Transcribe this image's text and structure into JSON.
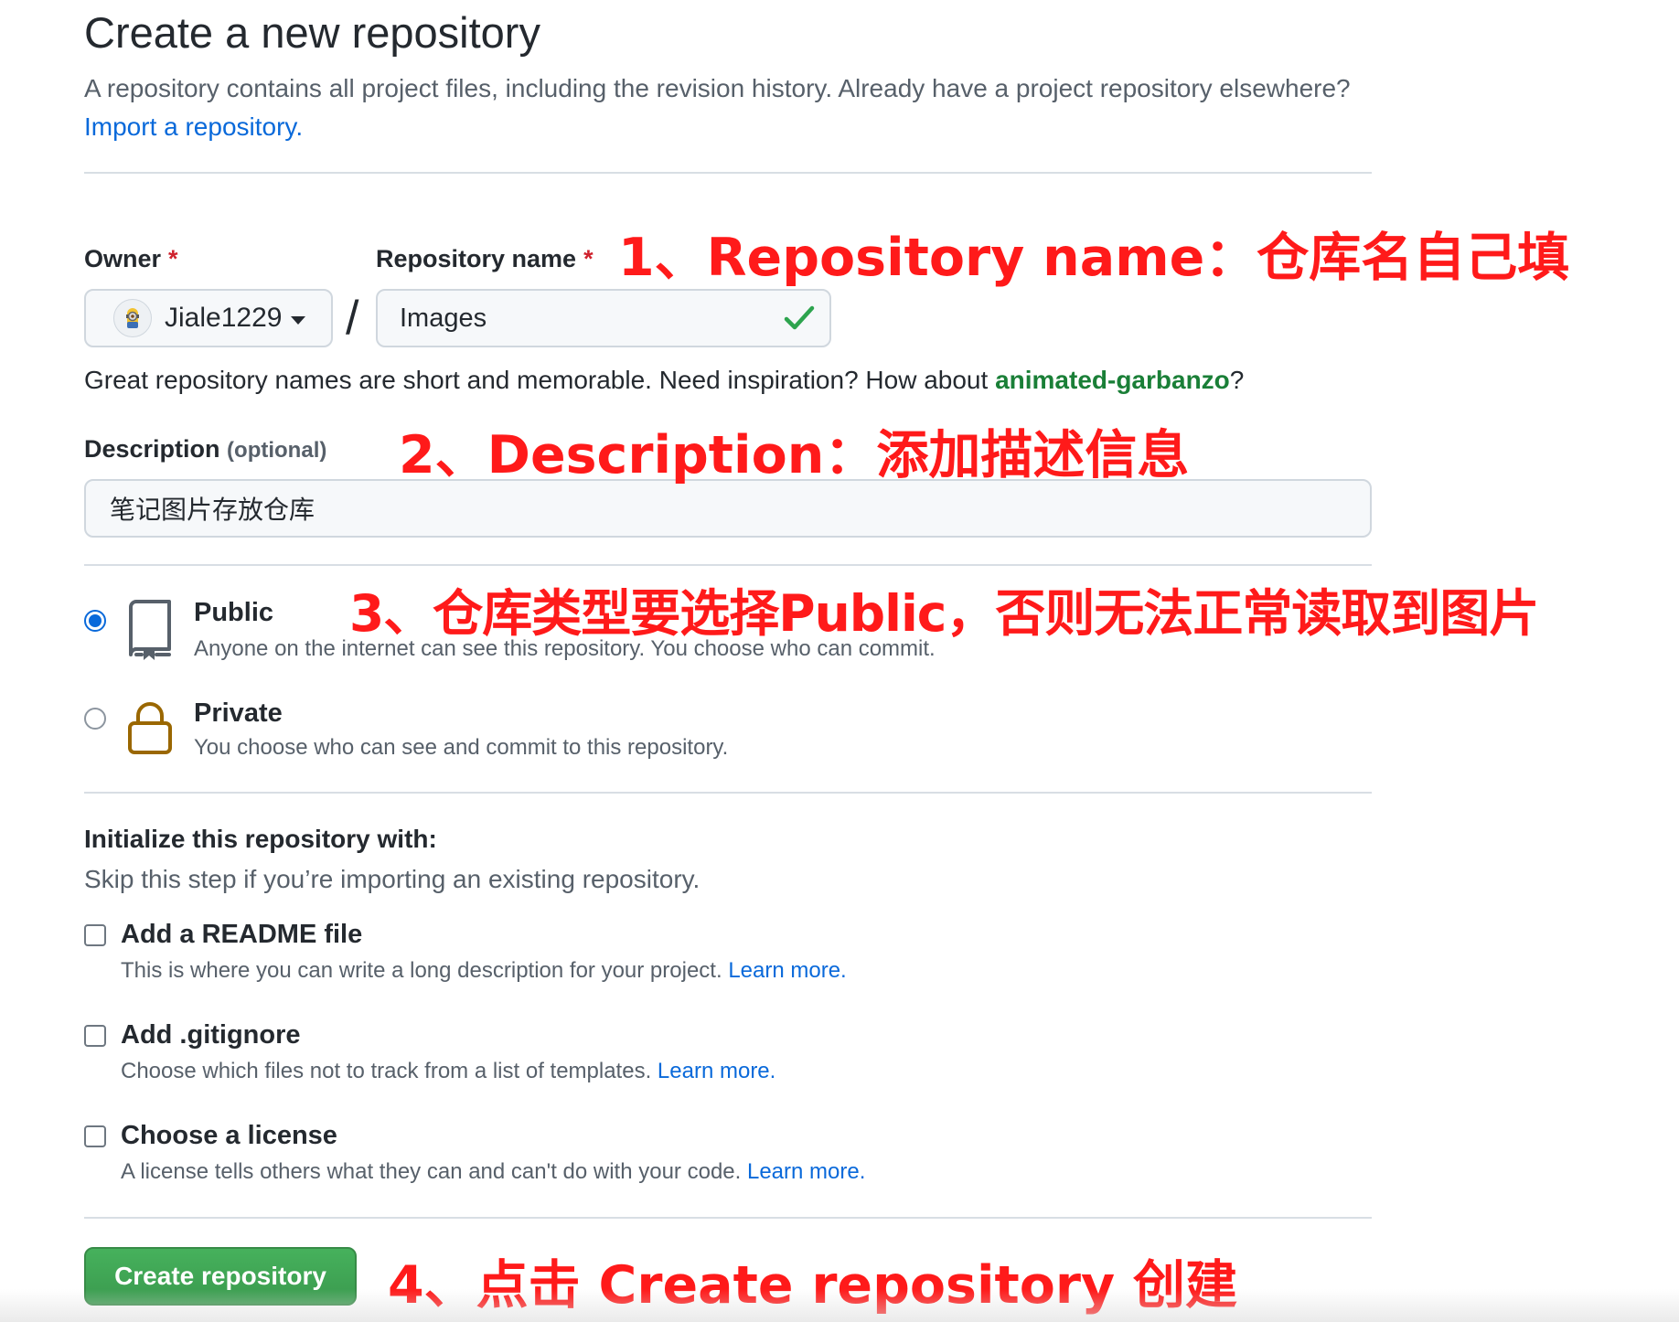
{
  "header": {
    "title": "Create a new repository",
    "intro": "A repository contains all project files, including the revision history. Already have a project repository elsewhere?",
    "import_link": "Import a repository."
  },
  "owner": {
    "label": "Owner",
    "required_mark": "*",
    "value": "Jiale1229",
    "avatar_icon": "minion-avatar"
  },
  "separator": "/",
  "repo_name": {
    "label": "Repository name",
    "required_mark": "*",
    "value": "Images",
    "valid_icon": "check-icon"
  },
  "name_hint": {
    "text": "Great repository names are short and memorable. Need inspiration? How about",
    "suggestion": "animated-garbanzo",
    "suffix": "?"
  },
  "description": {
    "label": "Description",
    "optional": "(optional)",
    "value": "笔记图片存放仓库"
  },
  "visibility": {
    "selected": "public",
    "public": {
      "title": "Public",
      "desc": "Anyone on the internet can see this repository. You choose who can commit.",
      "icon": "repo-icon"
    },
    "private": {
      "title": "Private",
      "desc": "You choose who can see and commit to this repository.",
      "icon": "lock-icon"
    }
  },
  "initialize": {
    "title": "Initialize this repository with:",
    "subtitle": "Skip this step if you’re importing an existing repository.",
    "options": [
      {
        "title": "Add a README file",
        "desc": "This is where you can write a long description for your project.",
        "link": "Learn more.",
        "checked": false
      },
      {
        "title": "Add .gitignore",
        "desc": "Choose which files not to track from a list of templates.",
        "link": "Learn more.",
        "checked": false
      },
      {
        "title": "Choose a license",
        "desc": "A license tells others what they can and can't do with your code.",
        "link": "Learn more.",
        "checked": false
      }
    ]
  },
  "create_button": "Create repository",
  "annotations": [
    "1、Repository name：仓库名自己填",
    "2、Description：添加描述信息",
    "3、仓库类型要选择Public，否则无法正常读取到图片",
    "4、点击 Create repository 创建"
  ],
  "colors": {
    "link": "#0969da",
    "suggestion": "#1a7f37",
    "annotation": "#ff1a1a",
    "button": "#2da44e",
    "required": "#cf222e"
  }
}
